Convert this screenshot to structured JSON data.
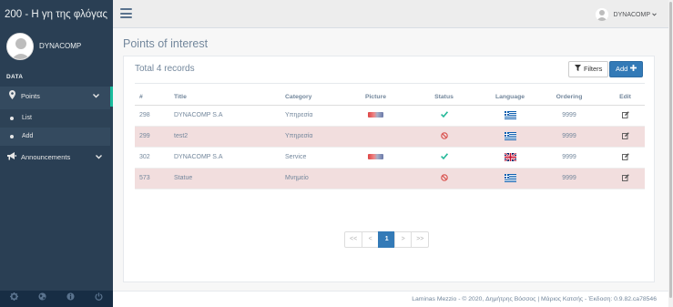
{
  "app": {
    "title": "200 - Η γη της φλόγας"
  },
  "profile": {
    "name": "DYNACOMP"
  },
  "sidebar": {
    "section": "DATA",
    "menu": [
      {
        "label": "Points",
        "icon": "map-marker-icon",
        "children": [
          {
            "label": "List"
          },
          {
            "label": "Add"
          }
        ]
      },
      {
        "label": "Announcements",
        "icon": "bullhorn-icon"
      }
    ],
    "footer_icons": [
      "gear-icon",
      "globe-icon",
      "info-icon",
      "power-icon"
    ]
  },
  "topnav": {
    "user": "DYNACOMP"
  },
  "page": {
    "title": "Points of interest",
    "total": "Total 4 records",
    "filters_label": "Filters",
    "add_label": "Add"
  },
  "table": {
    "headers": [
      "#",
      "Title",
      "Category",
      "Picture",
      "Status",
      "Language",
      "Ordering",
      "Edit"
    ],
    "rows": [
      {
        "id": "298",
        "title": "DYNACOMP S.A",
        "category": "Υπηρεσία",
        "picture": true,
        "status": "active",
        "language": "greek",
        "ordering": "9999",
        "highlight": false
      },
      {
        "id": "299",
        "title": "test2",
        "category": "Υπηρεσία",
        "picture": false,
        "status": "inactive",
        "language": "greek",
        "ordering": "9999",
        "highlight": true
      },
      {
        "id": "302",
        "title": "DYNACOMP S.A",
        "category": "Service",
        "picture": true,
        "status": "active",
        "language": "english",
        "ordering": "9999",
        "highlight": false
      },
      {
        "id": "573",
        "title": "Statue",
        "category": "Μνημείο",
        "picture": false,
        "status": "inactive",
        "language": "greek",
        "ordering": "9999",
        "highlight": true
      }
    ]
  },
  "pagination": {
    "first": "<<",
    "prev": "<",
    "current": "1",
    "next": ">",
    "last": ">>"
  },
  "footer": {
    "text": "Laminas Mezzio - © 2020, Δημήτρης Βόσσος | Μάριος Κατσής - Έκδοση: 0.9.82.ca78546"
  },
  "colors": {
    "sidebar": "#2a3f54",
    "accent": "#1abb9c",
    "primary": "#337ab7",
    "danger_row": "#f2dede"
  }
}
